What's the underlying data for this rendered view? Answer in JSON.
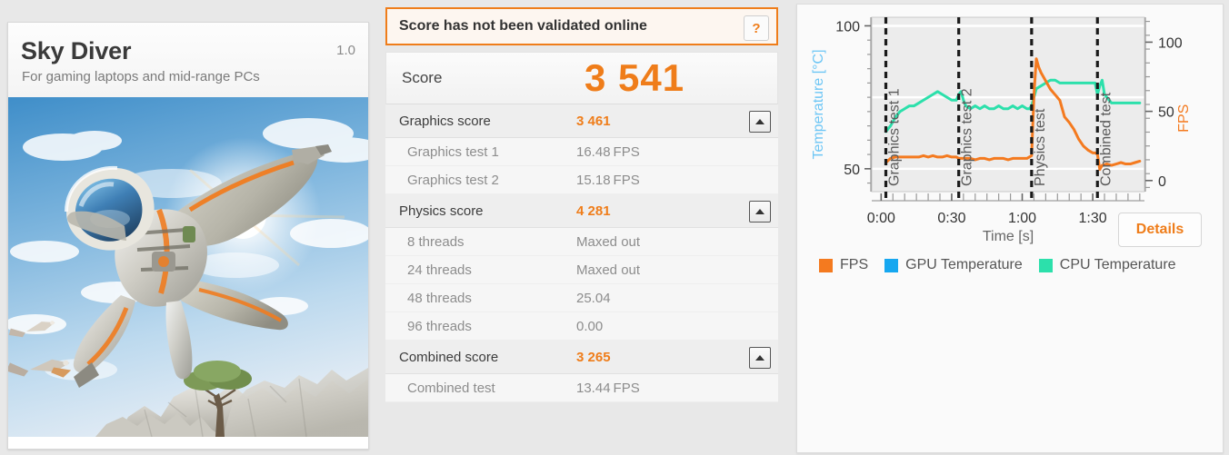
{
  "benchmark": {
    "name": "Sky Diver",
    "version": "1.0",
    "subtitle": "For gaming laptops and mid-range PCs",
    "hero_image_alt": "wingsuit-skydiver-over-canyon"
  },
  "validation": {
    "message": "Score has not been validated online",
    "help_label": "?",
    "accent_color": "#ef7d1a"
  },
  "score": {
    "label": "Score",
    "value": "3 541"
  },
  "sections": [
    {
      "label": "Graphics score",
      "value": "3 461",
      "toggle_icon": "collapse-triangle-icon",
      "rows": [
        {
          "label": "Graphics test 1",
          "value": "16.48",
          "unit": "FPS"
        },
        {
          "label": "Graphics test 2",
          "value": "15.18",
          "unit": "FPS"
        }
      ]
    },
    {
      "label": "Physics score",
      "value": "4 281",
      "toggle_icon": "collapse-triangle-icon",
      "rows": [
        {
          "label": "8 threads",
          "value": "Maxed out",
          "unit": ""
        },
        {
          "label": "24 threads",
          "value": "Maxed out",
          "unit": ""
        },
        {
          "label": "48 threads",
          "value": "25.04",
          "unit": ""
        },
        {
          "label": "96 threads",
          "value": "0.00",
          "unit": ""
        }
      ]
    },
    {
      "label": "Combined score",
      "value": "3 265",
      "toggle_icon": "collapse-triangle-icon",
      "rows": [
        {
          "label": "Combined test",
          "value": "13.44",
          "unit": "FPS"
        }
      ]
    }
  ],
  "details_button": {
    "label": "Details"
  },
  "legend": [
    {
      "label": "FPS",
      "color": "#f47a1f"
    },
    {
      "label": "GPU Temperature",
      "color": "#16a7f0"
    },
    {
      "label": "CPU Temperature",
      "color": "#2ce0ab"
    }
  ],
  "chart_data": {
    "type": "line",
    "title": "",
    "xlabel": "Time [s]",
    "ylabel": "Temperature [°C]",
    "y2label": "FPS",
    "xticks": [
      "0:00",
      "0:30",
      "1:00",
      "1:30"
    ],
    "xtick_seconds": [
      0,
      30,
      60,
      90
    ],
    "xlim": [
      -4,
      112
    ],
    "yticks_left": [
      50,
      100
    ],
    "ylim_left": [
      42,
      103
    ],
    "yticks_right": [
      0,
      50,
      100
    ],
    "ylim_right": [
      -8,
      118
    ],
    "grid": true,
    "legend_position": "below",
    "left_axis_color": "#6ec6f5",
    "right_axis_color": "#f47a1f",
    "phase_markers": [
      {
        "label": "Graphics test 1",
        "x": 2
      },
      {
        "label": "Graphics test 2",
        "x": 33
      },
      {
        "label": "Physics test",
        "x": 64
      },
      {
        "label": "Combined test",
        "x": 92
      }
    ],
    "series": [
      {
        "name": "CPU Temperature",
        "color": "#2ce0ab",
        "axis": "left",
        "unit": "°C",
        "x": [
          2,
          4,
          6,
          8,
          10,
          12,
          14,
          16,
          18,
          20,
          22,
          24,
          26,
          28,
          30,
          32,
          33,
          34,
          35,
          36,
          38,
          40,
          42,
          44,
          46,
          48,
          50,
          52,
          54,
          56,
          58,
          60,
          62,
          63,
          64,
          65,
          66,
          68,
          70,
          72,
          74,
          76,
          78,
          80,
          82,
          84,
          86,
          88,
          90,
          91,
          92,
          93,
          94,
          95,
          96,
          97,
          98,
          100,
          102,
          104,
          106,
          108,
          110
        ],
        "y": [
          63,
          65,
          68,
          70,
          71,
          72,
          72,
          73,
          74,
          75,
          76,
          77,
          76,
          75,
          74,
          74,
          76,
          77,
          74,
          72,
          71,
          72,
          71,
          72,
          71,
          71,
          72,
          71,
          71,
          72,
          71,
          72,
          71,
          71,
          72,
          75,
          78,
          79,
          80,
          81,
          81,
          80,
          80,
          80,
          80,
          80,
          80,
          80,
          80,
          80,
          76,
          79,
          81,
          76,
          75,
          74,
          73,
          73,
          73,
          73,
          73,
          73,
          73
        ]
      },
      {
        "name": "FPS",
        "color": "#f47a1f",
        "axis": "right",
        "unit": "FPS",
        "x": [
          2,
          4,
          6,
          8,
          10,
          12,
          14,
          16,
          18,
          20,
          22,
          24,
          26,
          28,
          30,
          32,
          33,
          34,
          36,
          38,
          40,
          42,
          44,
          46,
          48,
          50,
          52,
          54,
          56,
          58,
          60,
          62,
          63,
          64,
          65,
          66,
          67,
          68,
          70,
          72,
          74,
          76,
          78,
          80,
          82,
          84,
          86,
          88,
          90,
          91,
          92,
          93,
          94,
          96,
          98,
          100,
          102,
          104,
          106,
          108,
          110
        ],
        "y": [
          13,
          16,
          17,
          17,
          17,
          17,
          17,
          17,
          18,
          17,
          18,
          17,
          17,
          18,
          17,
          17,
          16,
          16,
          16,
          16,
          15,
          16,
          16,
          15,
          16,
          16,
          16,
          15,
          16,
          16,
          16,
          16,
          17,
          18,
          62,
          88,
          82,
          78,
          72,
          66,
          62,
          58,
          46,
          42,
          37,
          30,
          25,
          22,
          20,
          20,
          19,
          8,
          11,
          12,
          11,
          12,
          13,
          12,
          12,
          13,
          14
        ]
      }
    ]
  }
}
